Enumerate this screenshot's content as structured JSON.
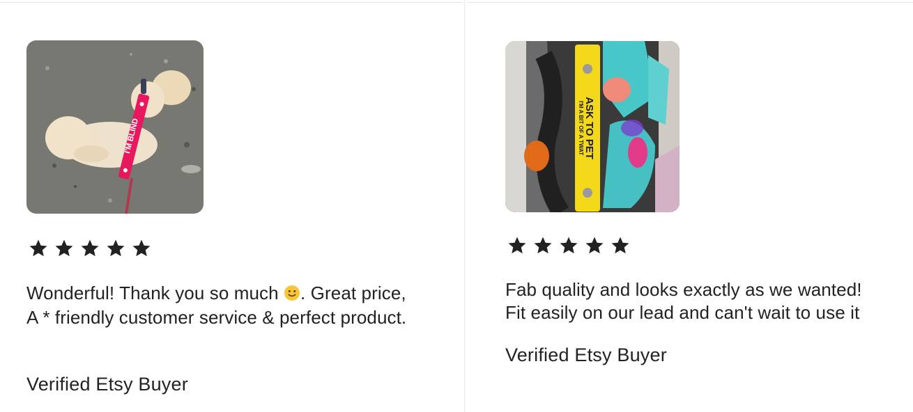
{
  "reviews": [
    {
      "rating": 5,
      "text_before_emoji": "Wonderful! Thank you so much ",
      "emoji": "slightly-smiling-face",
      "text_after_emoji": ". Great price, A * friendly customer service & perfect product.",
      "buyer": "Verified Etsy Buyer",
      "photo_caption": "I'M BLIND"
    },
    {
      "rating": 5,
      "text_line1": "Fab quality and looks exactly as we wanted!",
      "text_line2": "Fit easily on our lead and can't wait to use it",
      "buyer": "Verified Etsy Buyer",
      "photo_caption_main": "ASK TO PET",
      "photo_caption_sub": "I'M A BIT OF A TWAT"
    }
  ],
  "colors": {
    "star": "#222222",
    "text": "#222222",
    "lead_pink": "#e8185e",
    "lead_yellow": "#f3d91a"
  }
}
